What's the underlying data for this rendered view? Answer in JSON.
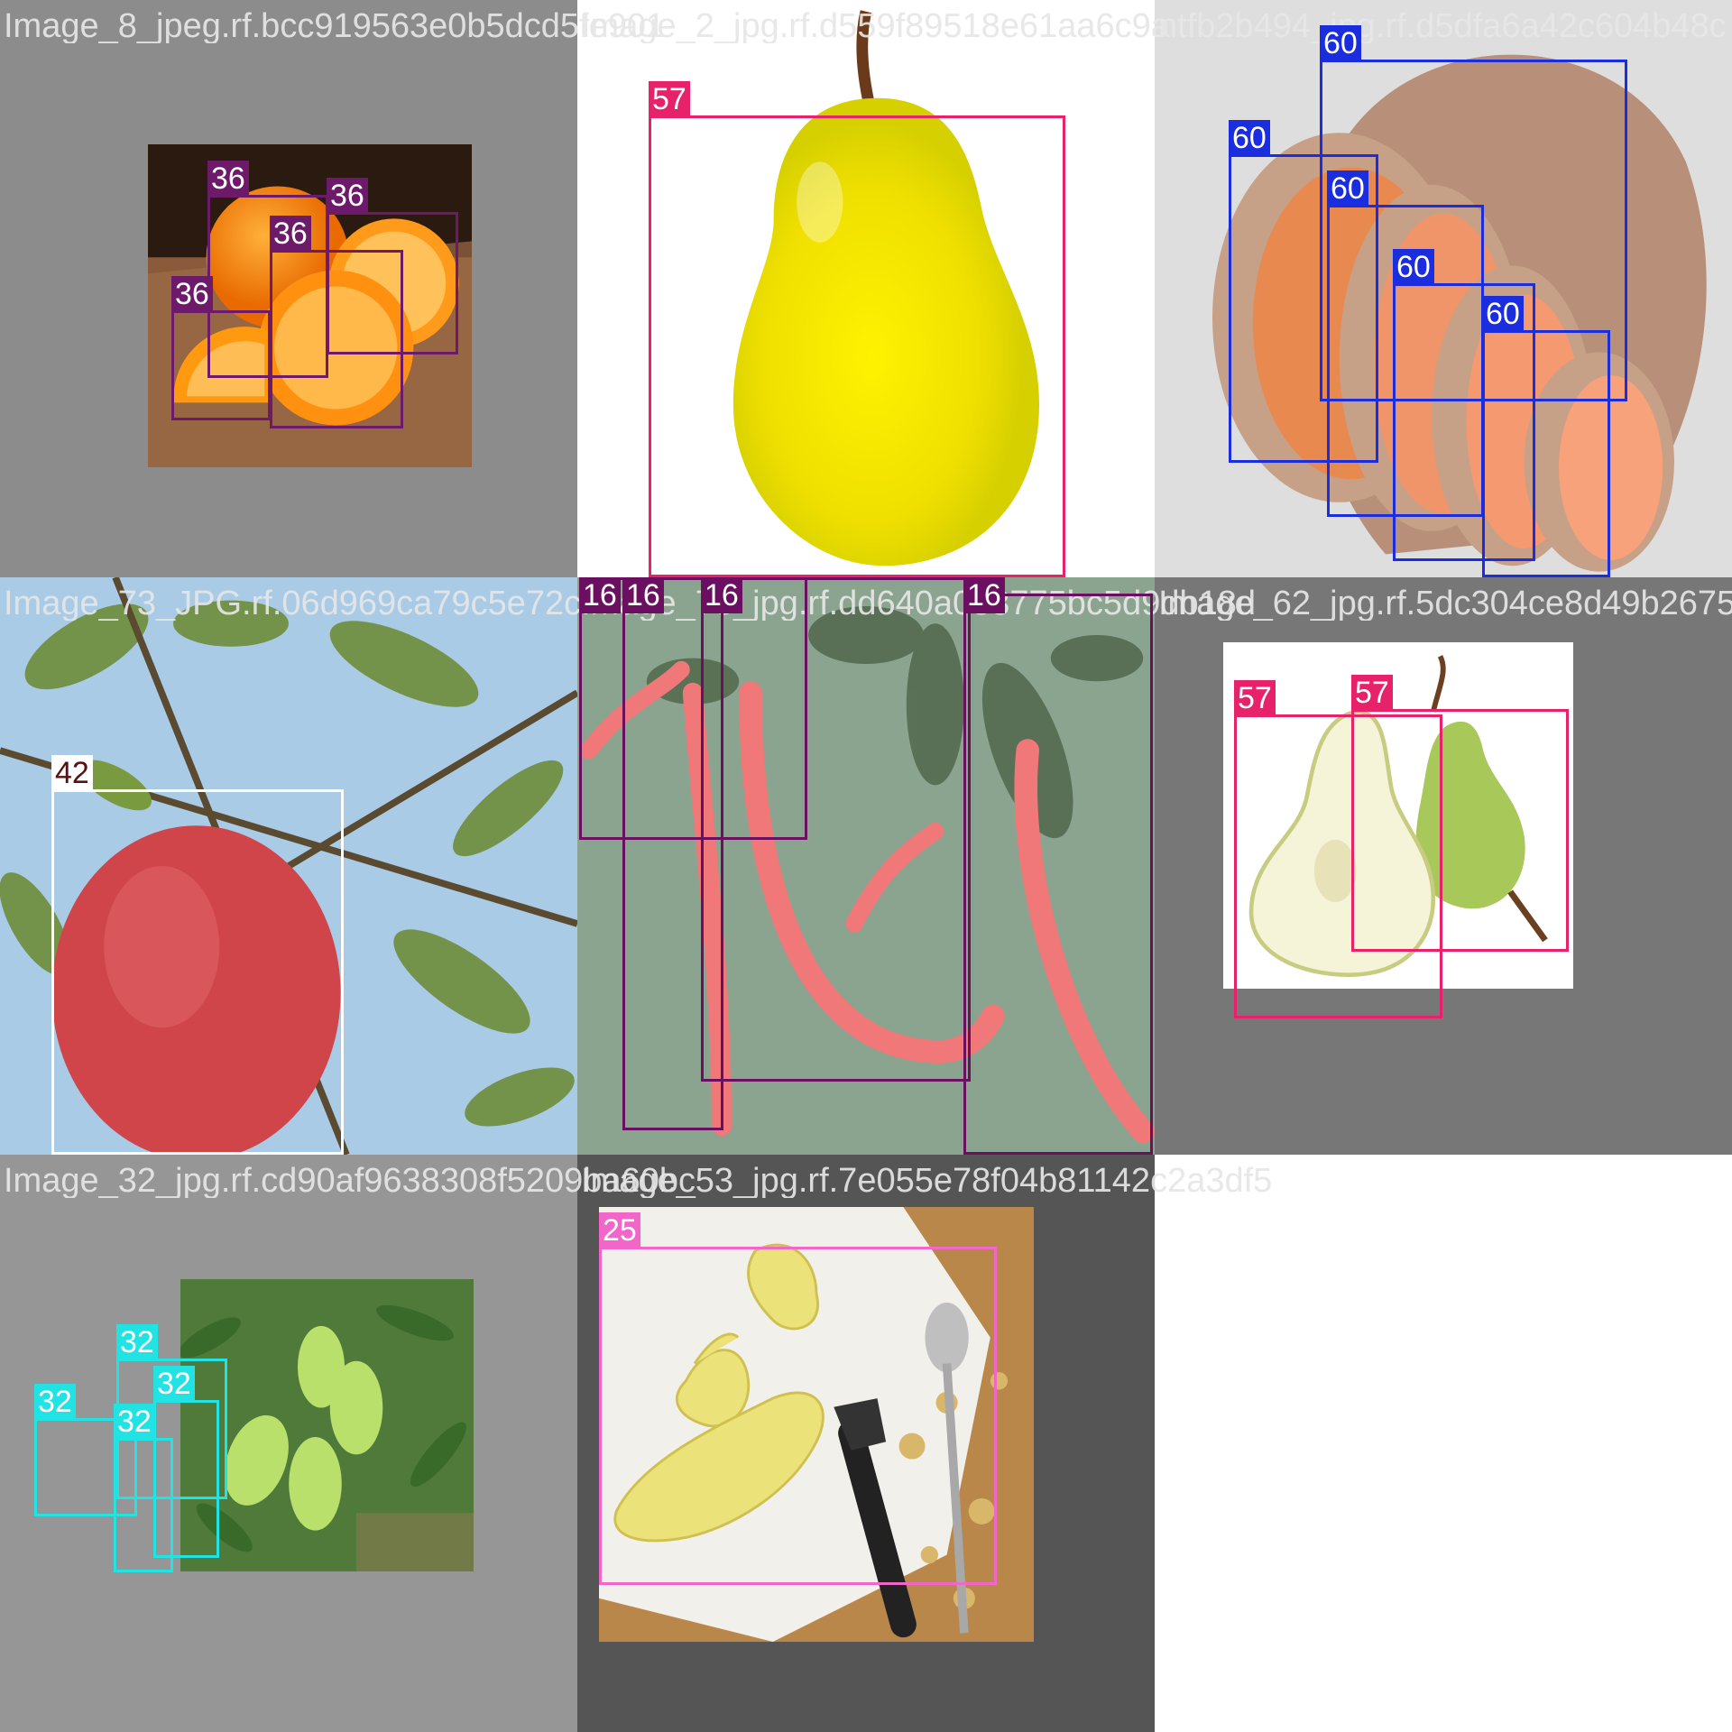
{
  "mosaic": {
    "tiles": [
      {
        "title": "Image_8_jpeg.rf.bcc919563e0b5dcd5fe901",
        "subject": "oranges on burlap",
        "background": "#8c8c8c",
        "boxes": [
          {
            "label": "36",
            "color": "#6e1a6b"
          },
          {
            "label": "36",
            "color": "#6e1a6b"
          },
          {
            "label": "36",
            "color": "#6e1a6b"
          },
          {
            "label": "36",
            "color": "#6e1a6b"
          }
        ]
      },
      {
        "title": "Image_2_jpg.rf.d559f89518e61aa6c9a",
        "subject": "yellow pear",
        "background": "#ffffff",
        "boxes": [
          {
            "label": "57",
            "color": "#e8216b"
          }
        ]
      },
      {
        "title": "ntfb2b494_jpg.rf.d5dfa6a42c604b48c",
        "subject": "sliced sweet potato",
        "background": "#dcdcdc",
        "boxes": [
          {
            "label": "60",
            "color": "#1a2ee0"
          },
          {
            "label": "60",
            "color": "#1a2ee0"
          },
          {
            "label": "60",
            "color": "#1a2ee0"
          },
          {
            "label": "60",
            "color": "#1a2ee0"
          },
          {
            "label": "60",
            "color": "#1a2ee0"
          }
        ]
      },
      {
        "title": "Image_73_JPG.rf.06d969ca79c5e72c",
        "subject": "pomegranate on tree",
        "background": "#9cc3e0",
        "boxes": [
          {
            "label": "42",
            "color": "#ffffff",
            "label_text_color": "#5a1010"
          }
        ]
      },
      {
        "title": "Image_73_jpg.rf.dd640a033775bc5d9db18d",
        "subject": "red chili peppers on plant",
        "background": "#8aa48a",
        "boxes": [
          {
            "label": "16",
            "color": "#6b1060"
          },
          {
            "label": "16",
            "color": "#6b1060"
          },
          {
            "label": "16",
            "color": "#6b1060"
          },
          {
            "label": "16",
            "color": "#6b1060"
          }
        ]
      },
      {
        "title": "Image_62_jpg.rf.5dc304ce8d49b2675",
        "subject": "halved pears",
        "background": "#777777",
        "boxes": [
          {
            "label": "57",
            "color": "#e8216b"
          },
          {
            "label": "57",
            "color": "#e8216b"
          }
        ]
      },
      {
        "title": "Image_32_jpg.rf.cd90af9638308f5209ba60bc",
        "subject": "green mangoes on tree",
        "background": "#969696",
        "boxes": [
          {
            "label": "32",
            "color": "#21e3e3"
          },
          {
            "label": "32",
            "color": "#21e3e3"
          },
          {
            "label": "32",
            "color": "#21e3e3"
          },
          {
            "label": "32",
            "color": "#21e3e3"
          }
        ]
      },
      {
        "title": "Image_53_jpg.rf.7e055e78f04b81142c2a3df5",
        "subject": "peeled ginger with peeler and spoon",
        "background": "#555555",
        "boxes": [
          {
            "label": "25",
            "color": "#f266c9"
          }
        ]
      }
    ]
  }
}
